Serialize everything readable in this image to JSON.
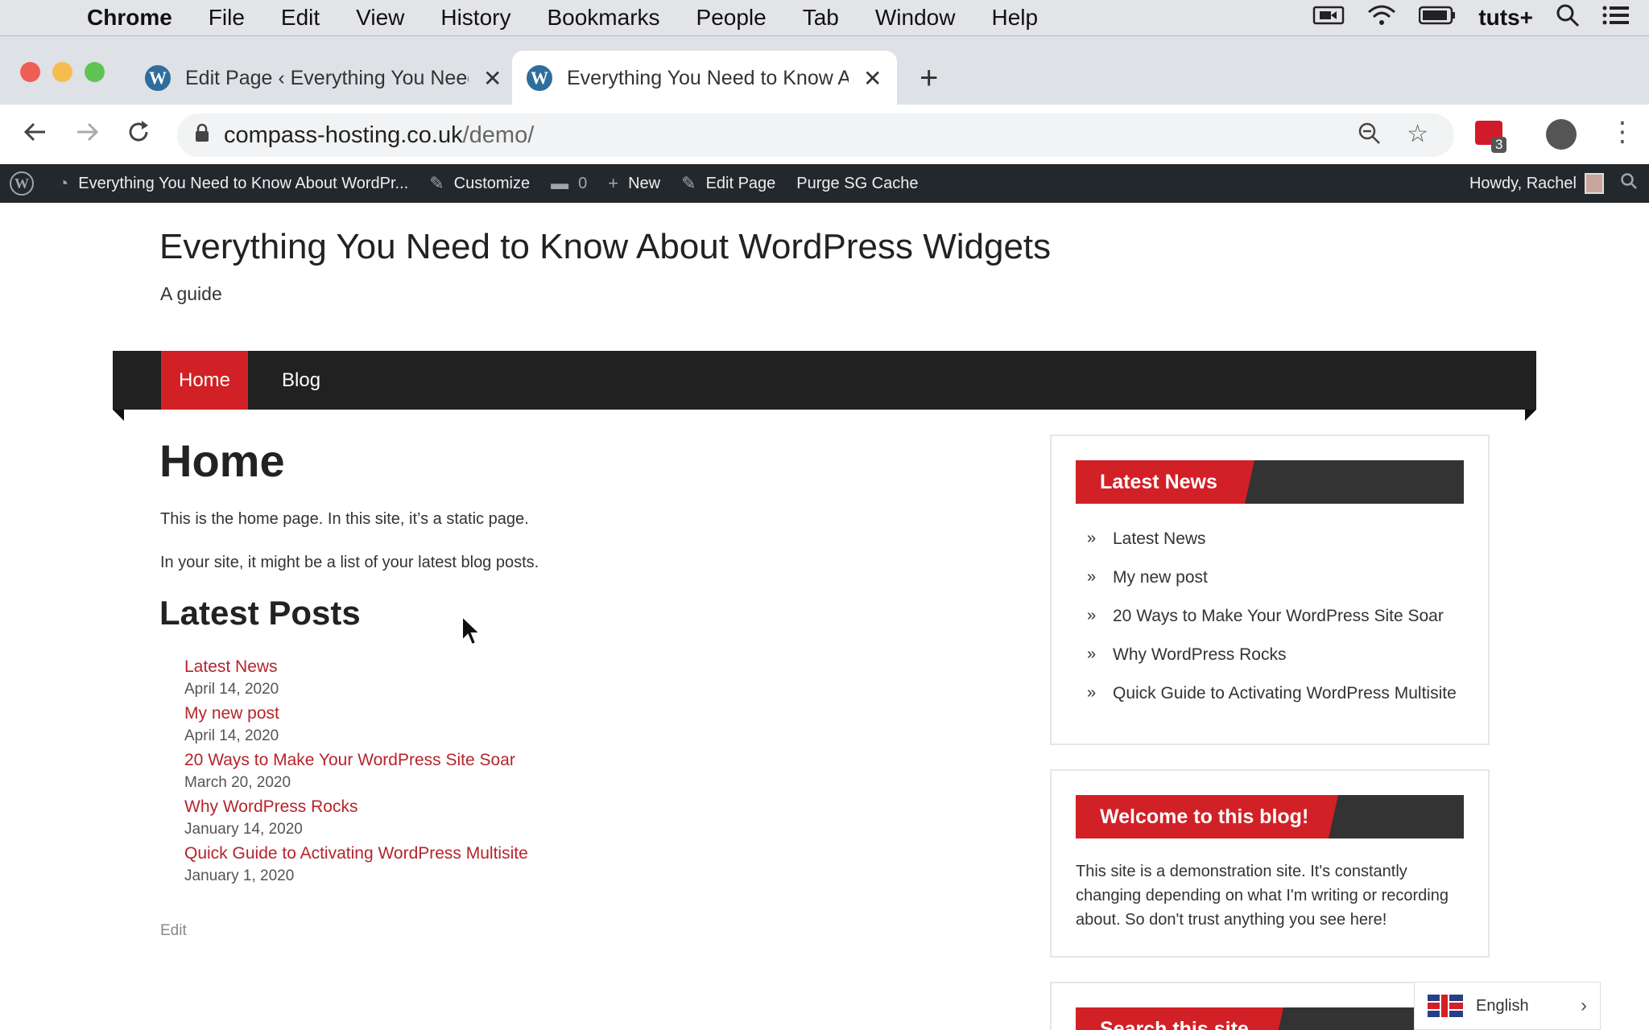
{
  "macos_menu": {
    "app": "Chrome",
    "items": [
      "File",
      "Edit",
      "View",
      "History",
      "Bookmarks",
      "People",
      "Tab",
      "Window",
      "Help"
    ],
    "tray_label": "tuts+"
  },
  "browser": {
    "tabs": [
      {
        "title": "Edit Page ‹ Everything You Need to Know About WordPress Widgets"
      },
      {
        "title": "Everything You Need to Know About WordPress Widgets"
      }
    ],
    "url_host": "compass-hosting.co.uk",
    "url_path": "/demo/",
    "extension_badge": "3"
  },
  "admin_bar": {
    "site_name": "Everything You Need to Know About WordPr...",
    "customize": "Customize",
    "comments_count": "0",
    "new": "New",
    "edit_page": "Edit Page",
    "purge": "Purge SG Cache",
    "howdy": "Howdy, Rachel"
  },
  "site": {
    "title": "Everything You Need to Know About WordPress Widgets",
    "description": "A guide",
    "nav": [
      "Home",
      "Blog"
    ]
  },
  "main": {
    "heading": "Home",
    "para1": "This is the home page. In this site, it’s a static page.",
    "para2": "In your site, it might be a list of your latest blog posts.",
    "latest_heading": "Latest Posts",
    "posts": [
      {
        "title": "Latest News",
        "date": "April 14, 2020"
      },
      {
        "title": "My new post",
        "date": "April 14, 2020"
      },
      {
        "title": "20 Ways to Make Your WordPress Site Soar",
        "date": "March 20, 2020"
      },
      {
        "title": "Why WordPress Rocks",
        "date": "January 14, 2020"
      },
      {
        "title": "Quick Guide to Activating WordPress Multisite",
        "date": "January 1, 2020"
      }
    ],
    "edit": "Edit"
  },
  "sidebar": {
    "latest_news_title": "Latest News",
    "latest_news_items": [
      "Latest News",
      "My new post",
      "20 Ways to Make Your WordPress Site Soar",
      "Why WordPress Rocks",
      "Quick Guide to Activating WordPress Multisite"
    ],
    "welcome_title": "Welcome to this blog!",
    "welcome_text": "This site is a demonstration site. It's constantly changing depending on what I'm writing or recording about. So don't trust anything you see here!",
    "search_title": "Search this site"
  },
  "language": {
    "label": "English"
  },
  "colors": {
    "accent_red": "#d12026",
    "link_red": "#b5242b",
    "dark_bar": "#212121",
    "admin_bar": "#23282d"
  }
}
